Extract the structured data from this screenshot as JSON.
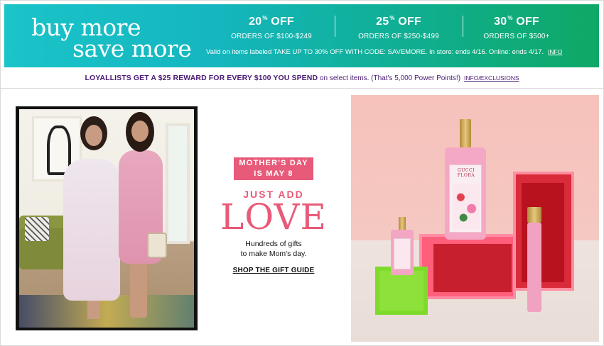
{
  "promo": {
    "headline_line1": "buy more",
    "headline_line2": "save more",
    "tiers": [
      {
        "percent": "20",
        "sup": "%",
        "off": "OFF",
        "range": "ORDERS OF $100-$249"
      },
      {
        "percent": "25",
        "sup": "%",
        "off": "OFF",
        "range": "ORDERS OF $250-$499"
      },
      {
        "percent": "30",
        "sup": "%",
        "off": "OFF",
        "range": "ORDERS OF $500+"
      }
    ],
    "note": "Valid on items labeled TAKE UP TO 30% OFF WITH CODE: SAVEMORE. In store: ends 4/16. Online: ends 4/17.",
    "info_link": "INFO",
    "gradient_start": "#1ac4c9",
    "gradient_end": "#0fa866"
  },
  "loyallists": {
    "bold_text": "LOYALLISTS GET A $25 REWARD FOR EVERY $100 YOU SPEND",
    "rest_text": " on select items. (That's 5,000 Power Points!)",
    "link": "INFO/EXCLUSIONS",
    "color": "#4a1a73"
  },
  "mothers_day": {
    "badge_line1": "MOTHER'S DAY",
    "badge_line2": "IS MAY 8",
    "kicker": "JUST ADD",
    "headline": "LOVE",
    "sub_line1": "Hundreds of gifts",
    "sub_line2": "to make Mom's day.",
    "cta": "SHOP THE GIFT GUIDE",
    "accent": "#e85a79"
  },
  "images": {
    "left": "photo-two-women",
    "right": "photo-gucci-flora-perfume",
    "perfume_label": "GUCCI FLORA"
  }
}
